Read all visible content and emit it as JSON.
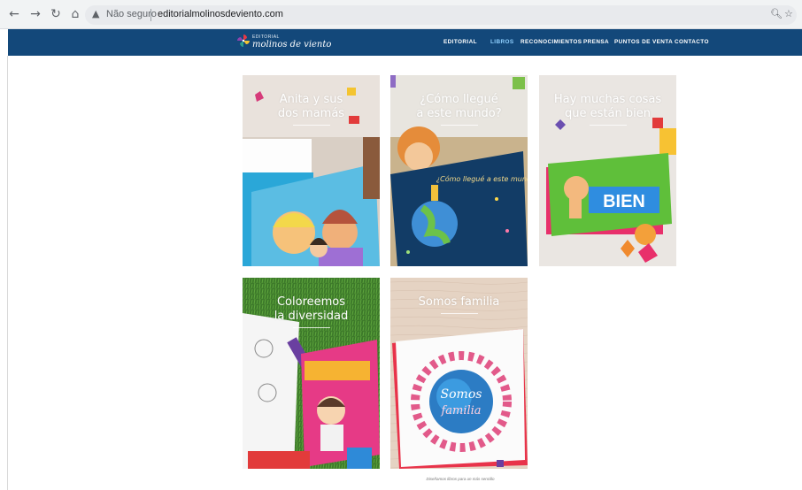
{
  "browser": {
    "security_label": "Não seguro",
    "url": "editorialmolinosdeviento.com",
    "back_icon": "arrow-left-icon",
    "forward_icon": "arrow-right-icon",
    "reload_icon": "reload-icon",
    "home_icon": "home-icon",
    "warning_icon": "warning-triangle-icon",
    "zoom_icon": "magnifier-icon",
    "bookmark_icon": "star-icon"
  },
  "site": {
    "logo_small": "EDITORIAL",
    "logo_big": "molinos de viento",
    "brand_color": "#13487a",
    "menu": [
      {
        "label": "EDITORIAL",
        "active": false
      },
      {
        "label": "LIBROS",
        "active": true
      },
      {
        "label": "RECONOCIMIENTOS",
        "active": false
      },
      {
        "label": "PRENSA",
        "active": false
      },
      {
        "label": "PUNTOS DE VENTA",
        "active": false
      },
      {
        "label": "CONTACTO",
        "active": false
      }
    ]
  },
  "books": [
    {
      "title_line1": "Anita y sus",
      "title_line2": "dos mamás",
      "cover_text": "Anita y sus dos mamás"
    },
    {
      "title_line1": "¿Cómo llegué",
      "title_line2": "a este mundo?",
      "cover_text": "¿Cómo llegué a este mundo?"
    },
    {
      "title_line1": "Hay muchas cosas",
      "title_line2": "que están bien",
      "cover_text": "BIEN"
    },
    {
      "title_line1": "Coloreemos",
      "title_line2": "la diversidad",
      "cover_text": "Coloreemos la diversidad"
    },
    {
      "title_line1": "Somos familia",
      "title_line2": "",
      "cover_text": "Somos familia"
    }
  ],
  "footer": {
    "note": "Diseñamos libros para un más sencillo"
  }
}
